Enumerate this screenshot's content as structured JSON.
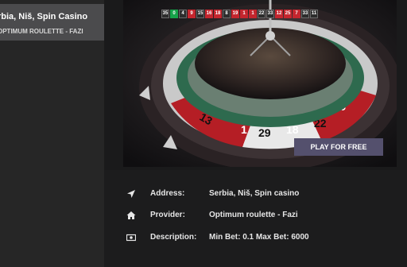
{
  "game_card": {
    "title": "rbia, Niš, Spin Casino",
    "subtitle": "OPTIMUM ROULETTE - FAZI"
  },
  "results": [
    {
      "n": "35",
      "color": "black"
    },
    {
      "n": "0",
      "color": "green"
    },
    {
      "n": "4",
      "color": "black"
    },
    {
      "n": "9",
      "color": "red"
    },
    {
      "n": "15",
      "color": "black"
    },
    {
      "n": "16",
      "color": "red"
    },
    {
      "n": "18",
      "color": "red"
    },
    {
      "n": "8",
      "color": "black"
    },
    {
      "n": "19",
      "color": "red"
    },
    {
      "n": "1",
      "color": "red"
    },
    {
      "n": "1",
      "color": "red"
    },
    {
      "n": "22",
      "color": "black"
    },
    {
      "n": "33",
      "color": "black"
    },
    {
      "n": "12",
      "color": "red"
    },
    {
      "n": "25",
      "color": "red"
    },
    {
      "n": "7",
      "color": "red"
    },
    {
      "n": "33",
      "color": "black"
    },
    {
      "n": "11",
      "color": "black"
    }
  ],
  "play_button": "PLAY FOR FREE",
  "details": [
    {
      "icon": "location-arrow-icon",
      "label": "Address:",
      "value": "Serbia, Niš, Spin casino"
    },
    {
      "icon": "home-icon",
      "label": "Provider:",
      "value": "Optimum roulette - Fazi"
    },
    {
      "icon": "money-bill-icon",
      "label": "Description:",
      "value": "Min Bet: 0.1 Max Bet: 6000"
    }
  ],
  "colors": {
    "red": "#c4262e",
    "green": "#16a34a",
    "black": "#2d2d2d",
    "button": "#54506d"
  }
}
